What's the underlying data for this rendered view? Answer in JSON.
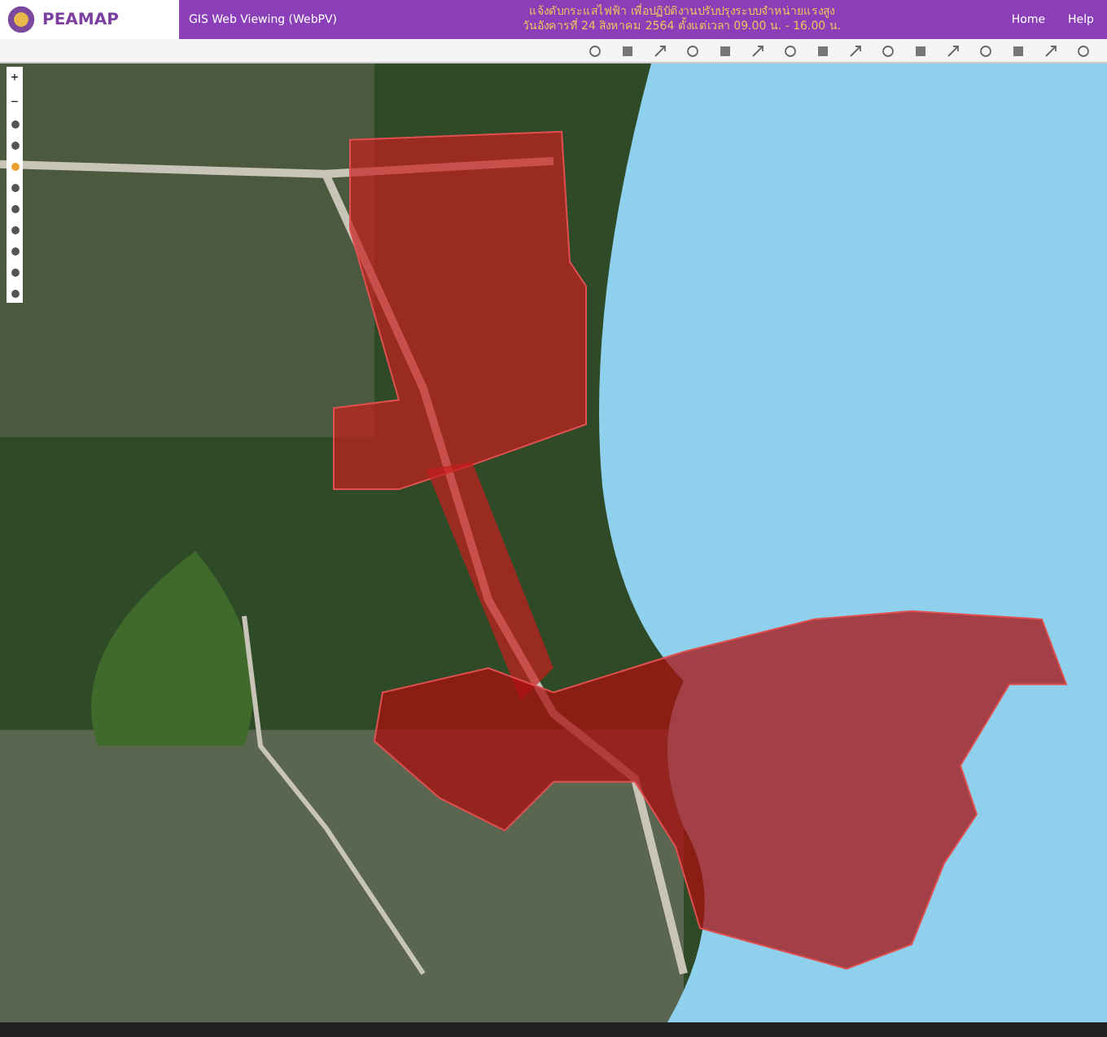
{
  "header": {
    "logo": "PEAMAP",
    "app_title": "GIS Web Viewing (WebPV)",
    "notice": [
      "แจ้งดับกระแสไฟฟ้า เพื่อปฏิบัติงานปรับปรุงระบบจำหน่ายแรงสูง",
      "วันอังคารที่ 24 สิงหาคม 2564 ตั้งแต่เวลา 09.00 น. - 16.00 น."
    ],
    "nav": [
      "Home",
      "Help"
    ]
  },
  "zoom": {
    "in": "+",
    "out": "−"
  }
}
